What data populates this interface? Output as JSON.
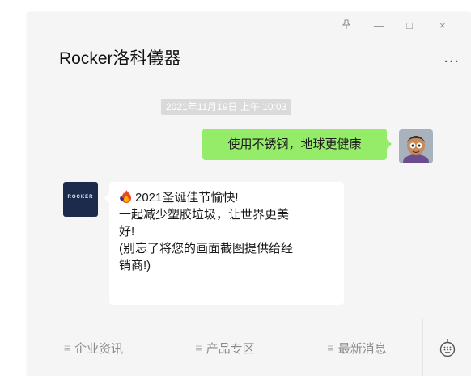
{
  "window": {
    "pin_icon": "pin-icon",
    "minimize_label": "—",
    "maximize_label": "□",
    "close_label": "×"
  },
  "chat": {
    "title": "Rocker洛科儀器",
    "more_label": "...",
    "timestamp": "2021年11月19日 上午 10:03",
    "outgoing_message": "使用不锈钢，地球更健康",
    "brand_avatar_text": "ROCKER",
    "incoming_message": [
      "2021圣诞佳节愉快!",
      "一起减少塑胶垃圾，让世界更美",
      "好!",
      "(别忘了将您的画面截图提供给经",
      "销商!)"
    ]
  },
  "footer": {
    "items": [
      {
        "label": "企业资讯"
      },
      {
        "label": "产品专区"
      },
      {
        "label": "最新消息"
      }
    ],
    "keyboard_icon": "keyboard-switch-icon"
  },
  "colors": {
    "outgoing_bubble": "#95ec69",
    "incoming_bubble": "#ffffff",
    "background": "#f5f5f5",
    "timestamp_bg": "#dadada"
  }
}
